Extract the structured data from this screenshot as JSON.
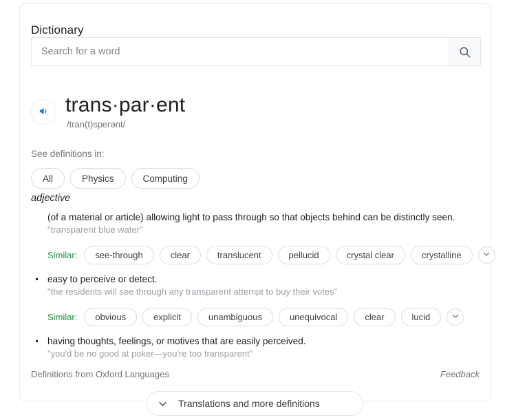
{
  "card": {
    "title": "Dictionary"
  },
  "search": {
    "placeholder": "Search for a word",
    "value": "",
    "icon": "search-icon"
  },
  "entry": {
    "word": "trans·par·ent",
    "phonetic": "/tran(t)sperənt/",
    "audio_icon": "speaker-icon",
    "part_of_speech": "adjective"
  },
  "definitions_in": {
    "label": "See definitions in:",
    "chips": [
      {
        "label": "All"
      },
      {
        "label": "Physics"
      },
      {
        "label": "Computing"
      }
    ]
  },
  "senses": [
    {
      "text": "(of a material or article) allowing light to pass through so that objects behind can be distinctly seen.",
      "example": "\"transparent blue water\"",
      "bulleted": false,
      "similar": {
        "label": "Similar:",
        "words": [
          "see-through",
          "clear",
          "translucent",
          "pellucid",
          "crystal clear",
          "crystalline"
        ],
        "expand_icon": "chevron-down-icon"
      }
    },
    {
      "text": "easy to perceive or detect.",
      "example": "\"the residents will see through any transparent attempt to buy their votes\"",
      "bulleted": true,
      "similar": {
        "label": "Similar:",
        "words": [
          "obvious",
          "explicit",
          "unambiguous",
          "unequivocal",
          "clear",
          "lucid"
        ],
        "expand_icon": "chevron-down-icon"
      }
    },
    {
      "text": "having thoughts, feelings, or motives that are easily perceived.",
      "example": "\"you'd be no good at poker—you're too transparent\"",
      "bulleted": true,
      "similar": null
    }
  ],
  "footer": {
    "source": "Definitions from Oxford Languages",
    "feedback": "Feedback"
  },
  "more": {
    "label": "Translations and more definitions",
    "icon": "chevron-down-icon"
  },
  "colors": {
    "accent_blue": "#1a73e8",
    "similar_green": "#1e8e3e",
    "text_primary": "#202124",
    "text_secondary": "#70757a",
    "example_gray": "#9aa0a6",
    "border": "#dadce0",
    "card_border": "#e8eaed"
  }
}
